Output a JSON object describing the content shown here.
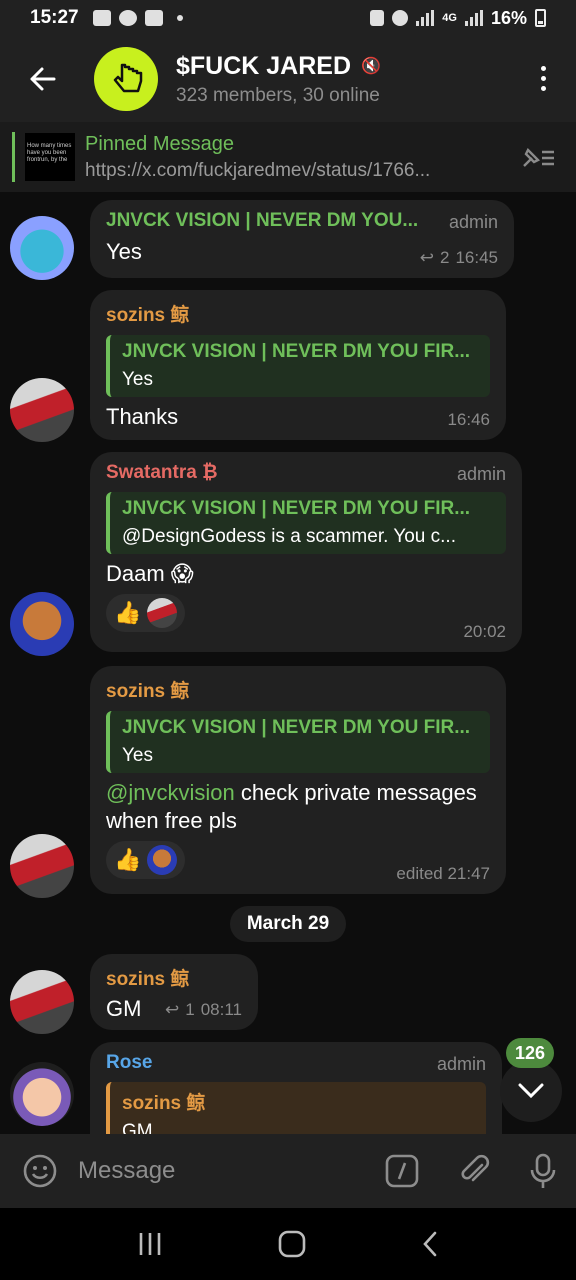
{
  "status_bar": {
    "time": "15:27",
    "network": "4G",
    "battery": "16%"
  },
  "header": {
    "title": "$FUCK JARED",
    "subtitle": "323 members, 30 online"
  },
  "pinned": {
    "title": "Pinned Message",
    "link": "https://x.com/fuckjaredmev/status/1766...",
    "thumb_text": "How many times have you been frontrun, by the"
  },
  "messages": [
    {
      "sender": "JNVCK VISION | NEVER DM YOU...",
      "role": "admin",
      "text": "Yes",
      "replies": "2",
      "time": "16:45"
    },
    {
      "sender": "sozins 鲸",
      "reply_name": "JNVCK VISION | NEVER DM YOU FIR...",
      "reply_text": "Yes",
      "text": "Thanks",
      "time": "16:46"
    },
    {
      "sender": "Swatantra ₿",
      "role": "admin",
      "reply_name": "JNVCK VISION | NEVER DM YOU FIR...",
      "reply_text": "@DesignGodess is a scammer. You c...",
      "text": "Daam 😱",
      "reaction": "👍",
      "time": "20:02"
    },
    {
      "sender": "sozins 鲸",
      "reply_name": "JNVCK VISION | NEVER DM YOU FIR...",
      "reply_text": "Yes",
      "mention": "@jnvckvision",
      "text": " check private messages when free pls",
      "reaction": "👍",
      "time": "edited 21:47"
    },
    {
      "sender": "sozins 鲸",
      "text": "GM",
      "replies": "1",
      "time": "08:11"
    },
    {
      "sender": "Rose",
      "role": "admin",
      "reply_name": "sozins 鲸",
      "reply_text": "GM"
    }
  ],
  "date_chip": "March 29",
  "unread_badge": "126",
  "input": {
    "placeholder": "Message"
  },
  "colors": {
    "accent_green": "#6fbf5a",
    "sender_orange": "#e39a44",
    "sender_red": "#e56a64",
    "sender_blue": "#58a6e8",
    "bubble": "#212121",
    "group_avatar": "#c8f01e"
  }
}
